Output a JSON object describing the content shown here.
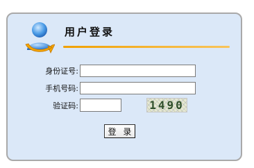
{
  "panel": {
    "title": "用户登录",
    "icon": "user-avatar-icon",
    "accent_color": "#f0a000",
    "background_color": "#dbe8f8"
  },
  "form": {
    "id_label": "身份证号:",
    "id_value": "",
    "phone_label": "手机号码:",
    "phone_value": "",
    "captcha_label": "验证码:",
    "captcha_value": "",
    "captcha_code": "1490"
  },
  "login_button": "登 录"
}
